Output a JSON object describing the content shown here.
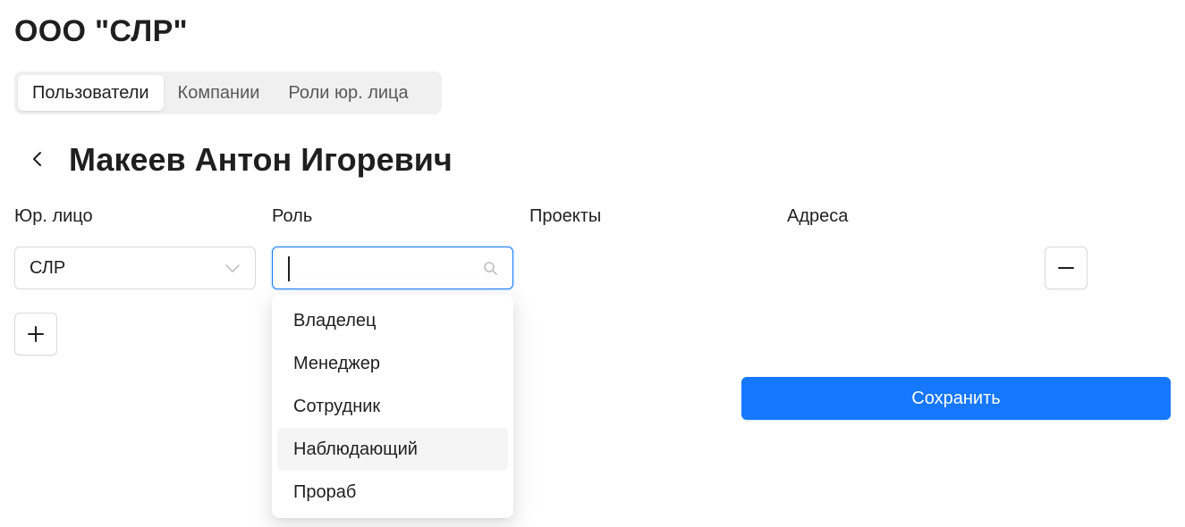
{
  "company": {
    "title": "ООО \"СЛР\""
  },
  "tabs": [
    {
      "label": "Пользователи",
      "active": true
    },
    {
      "label": "Компании",
      "active": false
    },
    {
      "label": "Роли юр. лица",
      "active": false
    }
  ],
  "user": {
    "name": "Макеев Антон Игоревич"
  },
  "columns": {
    "legal_entity": "Юр. лицо",
    "role": "Роль",
    "projects": "Проекты",
    "addresses": "Адреса"
  },
  "row": {
    "legal_entity_value": "СЛР",
    "role_input_value": ""
  },
  "role_options": [
    {
      "label": "Владелец",
      "active": false
    },
    {
      "label": "Менеджер",
      "active": false
    },
    {
      "label": "Сотрудник",
      "active": false
    },
    {
      "label": "Наблюдающий",
      "active": true
    },
    {
      "label": "Прораб",
      "active": false
    }
  ],
  "actions": {
    "save_label": "Сохранить"
  },
  "colors": {
    "primary": "#1677ff",
    "text": "#1f1f1f",
    "border": "#d9d9d9",
    "tab_bg": "#f0f0f0",
    "option_hover": "#f5f5f5"
  },
  "icons": {
    "back": "chevron-left-icon",
    "select_arrow": "chevron-down-icon",
    "search": "search-icon",
    "remove": "minus-icon",
    "add": "plus-icon"
  }
}
